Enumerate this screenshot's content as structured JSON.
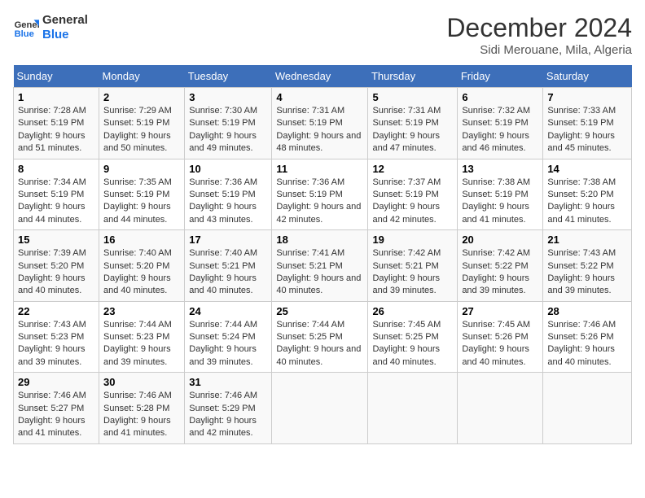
{
  "header": {
    "logo_line1": "General",
    "logo_line2": "Blue",
    "month_title": "December 2024",
    "location": "Sidi Merouane, Mila, Algeria"
  },
  "days_of_week": [
    "Sunday",
    "Monday",
    "Tuesday",
    "Wednesday",
    "Thursday",
    "Friday",
    "Saturday"
  ],
  "weeks": [
    [
      {
        "day": "1",
        "sunrise": "7:28 AM",
        "sunset": "5:19 PM",
        "daylight": "9 hours and 51 minutes."
      },
      {
        "day": "2",
        "sunrise": "7:29 AM",
        "sunset": "5:19 PM",
        "daylight": "9 hours and 50 minutes."
      },
      {
        "day": "3",
        "sunrise": "7:30 AM",
        "sunset": "5:19 PM",
        "daylight": "9 hours and 49 minutes."
      },
      {
        "day": "4",
        "sunrise": "7:31 AM",
        "sunset": "5:19 PM",
        "daylight": "9 hours and 48 minutes."
      },
      {
        "day": "5",
        "sunrise": "7:31 AM",
        "sunset": "5:19 PM",
        "daylight": "9 hours and 47 minutes."
      },
      {
        "day": "6",
        "sunrise": "7:32 AM",
        "sunset": "5:19 PM",
        "daylight": "9 hours and 46 minutes."
      },
      {
        "day": "7",
        "sunrise": "7:33 AM",
        "sunset": "5:19 PM",
        "daylight": "9 hours and 45 minutes."
      }
    ],
    [
      {
        "day": "8",
        "sunrise": "7:34 AM",
        "sunset": "5:19 PM",
        "daylight": "9 hours and 44 minutes."
      },
      {
        "day": "9",
        "sunrise": "7:35 AM",
        "sunset": "5:19 PM",
        "daylight": "9 hours and 44 minutes."
      },
      {
        "day": "10",
        "sunrise": "7:36 AM",
        "sunset": "5:19 PM",
        "daylight": "9 hours and 43 minutes."
      },
      {
        "day": "11",
        "sunrise": "7:36 AM",
        "sunset": "5:19 PM",
        "daylight": "9 hours and 42 minutes."
      },
      {
        "day": "12",
        "sunrise": "7:37 AM",
        "sunset": "5:19 PM",
        "daylight": "9 hours and 42 minutes."
      },
      {
        "day": "13",
        "sunrise": "7:38 AM",
        "sunset": "5:19 PM",
        "daylight": "9 hours and 41 minutes."
      },
      {
        "day": "14",
        "sunrise": "7:38 AM",
        "sunset": "5:20 PM",
        "daylight": "9 hours and 41 minutes."
      }
    ],
    [
      {
        "day": "15",
        "sunrise": "7:39 AM",
        "sunset": "5:20 PM",
        "daylight": "9 hours and 40 minutes."
      },
      {
        "day": "16",
        "sunrise": "7:40 AM",
        "sunset": "5:20 PM",
        "daylight": "9 hours and 40 minutes."
      },
      {
        "day": "17",
        "sunrise": "7:40 AM",
        "sunset": "5:21 PM",
        "daylight": "9 hours and 40 minutes."
      },
      {
        "day": "18",
        "sunrise": "7:41 AM",
        "sunset": "5:21 PM",
        "daylight": "9 hours and 40 minutes."
      },
      {
        "day": "19",
        "sunrise": "7:42 AM",
        "sunset": "5:21 PM",
        "daylight": "9 hours and 39 minutes."
      },
      {
        "day": "20",
        "sunrise": "7:42 AM",
        "sunset": "5:22 PM",
        "daylight": "9 hours and 39 minutes."
      },
      {
        "day": "21",
        "sunrise": "7:43 AM",
        "sunset": "5:22 PM",
        "daylight": "9 hours and 39 minutes."
      }
    ],
    [
      {
        "day": "22",
        "sunrise": "7:43 AM",
        "sunset": "5:23 PM",
        "daylight": "9 hours and 39 minutes."
      },
      {
        "day": "23",
        "sunrise": "7:44 AM",
        "sunset": "5:23 PM",
        "daylight": "9 hours and 39 minutes."
      },
      {
        "day": "24",
        "sunrise": "7:44 AM",
        "sunset": "5:24 PM",
        "daylight": "9 hours and 39 minutes."
      },
      {
        "day": "25",
        "sunrise": "7:44 AM",
        "sunset": "5:25 PM",
        "daylight": "9 hours and 40 minutes."
      },
      {
        "day": "26",
        "sunrise": "7:45 AM",
        "sunset": "5:25 PM",
        "daylight": "9 hours and 40 minutes."
      },
      {
        "day": "27",
        "sunrise": "7:45 AM",
        "sunset": "5:26 PM",
        "daylight": "9 hours and 40 minutes."
      },
      {
        "day": "28",
        "sunrise": "7:46 AM",
        "sunset": "5:26 PM",
        "daylight": "9 hours and 40 minutes."
      }
    ],
    [
      {
        "day": "29",
        "sunrise": "7:46 AM",
        "sunset": "5:27 PM",
        "daylight": "9 hours and 41 minutes."
      },
      {
        "day": "30",
        "sunrise": "7:46 AM",
        "sunset": "5:28 PM",
        "daylight": "9 hours and 41 minutes."
      },
      {
        "day": "31",
        "sunrise": "7:46 AM",
        "sunset": "5:29 PM",
        "daylight": "9 hours and 42 minutes."
      },
      null,
      null,
      null,
      null
    ]
  ],
  "labels": {
    "sunrise": "Sunrise:",
    "sunset": "Sunset:",
    "daylight": "Daylight:"
  }
}
